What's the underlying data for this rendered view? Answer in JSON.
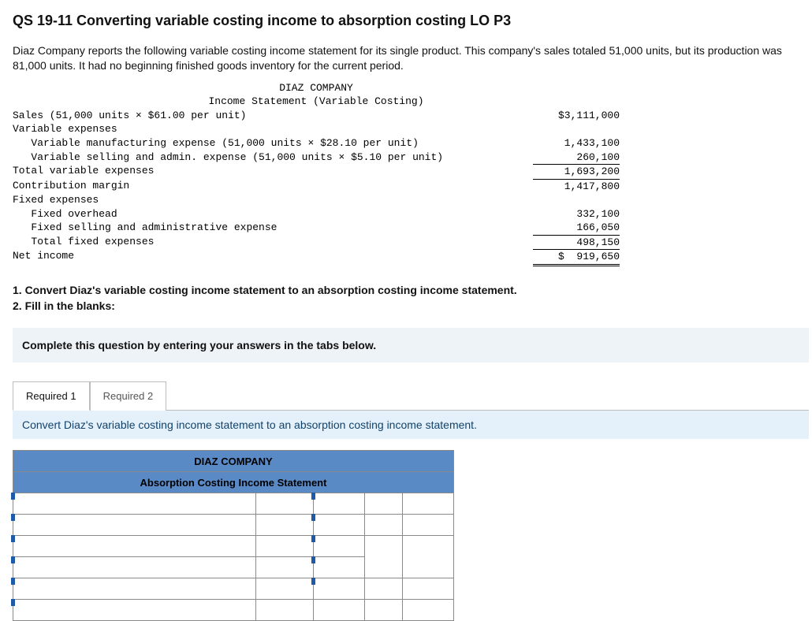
{
  "title": "QS 19-11 Converting variable costing income to absorption costing LO P3",
  "intro": "Diaz Company reports the following variable costing income statement for its single product. This company's sales totaled 51,000 units, but its production was 81,000 units. It had no beginning finished goods inventory for the current period.",
  "stmt": {
    "company": "DIAZ COMPANY",
    "heading": "Income Statement (Variable Costing)",
    "lines": {
      "sales_lbl": "Sales (51,000 units × $61.00 per unit)",
      "sales_val": "$3,111,000",
      "varexp_hdr": "Variable expenses",
      "varmfg_lbl": "   Variable manufacturing expense (51,000 units × $28.10 per unit)",
      "varmfg_val": "1,433,100",
      "varsell_lbl": "   Variable selling and admin. expense (51,000 units × $5.10 per unit)",
      "varsell_val": "260,100",
      "tve_lbl": "Total variable expenses",
      "tve_val": "1,693,200",
      "cm_lbl": "Contribution margin",
      "cm_val": "1,417,800",
      "fixexp_hdr": "Fixed expenses",
      "foh_lbl": "   Fixed overhead",
      "foh_val": "332,100",
      "fsa_lbl": "   Fixed selling and administrative expense",
      "fsa_val": "166,050",
      "tfe_lbl": "   Total fixed expenses",
      "tfe_val": "498,150",
      "ni_lbl": "Net income",
      "ni_val": "$  919,650"
    }
  },
  "tasks": {
    "t1": "1. Convert Diaz's variable costing income statement to an absorption costing income statement.",
    "t2": "2. Fill in the blanks:"
  },
  "instruction": "Complete this question by entering your answers in the tabs below.",
  "tabs": {
    "r1": "Required 1",
    "r2": "Required 2"
  },
  "sub_instruction": "Convert Diaz's variable costing income statement to an absorption costing income statement.",
  "ans_header": {
    "company": "DIAZ COMPANY",
    "title": "Absorption Costing Income Statement"
  },
  "chart_data": {
    "type": "table",
    "title": "DIAZ COMPANY Income Statement (Variable Costing)",
    "rows": [
      {
        "label": "Sales (51,000 units × $61.00 per unit)",
        "value": 3111000
      },
      {
        "label": "Variable manufacturing expense (51,000 units × $28.10 per unit)",
        "value": 1433100
      },
      {
        "label": "Variable selling and admin. expense (51,000 units × $5.10 per unit)",
        "value": 260100
      },
      {
        "label": "Total variable expenses",
        "value": 1693200
      },
      {
        "label": "Contribution margin",
        "value": 1417800
      },
      {
        "label": "Fixed overhead",
        "value": 332100
      },
      {
        "label": "Fixed selling and administrative expense",
        "value": 166050
      },
      {
        "label": "Total fixed expenses",
        "value": 498150
      },
      {
        "label": "Net income",
        "value": 919650
      }
    ]
  }
}
